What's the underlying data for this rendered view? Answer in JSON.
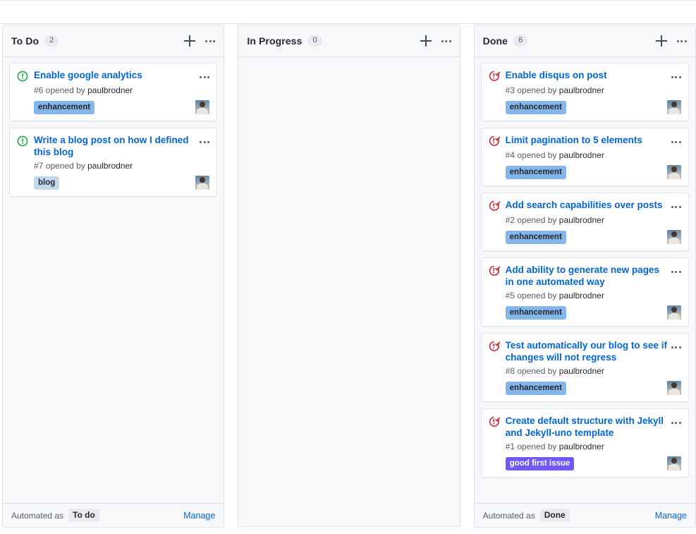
{
  "board": {
    "columns": [
      {
        "id": "todo",
        "title": "To Do",
        "count": "2",
        "add_icon": "plus-icon",
        "menu_icon": "kebab-menu-icon",
        "footer": {
          "automated_text": "Automated as",
          "badge": "To do",
          "manage": "Manage"
        },
        "cards": [
          {
            "state": "issue-opened-icon",
            "state_color": "#28a745",
            "title": "Enable google analytics",
            "meta_number": "#6",
            "meta_text": "opened by",
            "meta_author": "paulbrodner",
            "label": "enhancement",
            "label_bg": "#84b6eb",
            "label_fg": "#24292e",
            "avatar": "paulbrodner-avatar",
            "menu_icon": "card-kebab-menu-icon"
          },
          {
            "state": "issue-opened-icon",
            "state_color": "#28a745",
            "title": "Write a blog post on how I defined this blog",
            "meta_number": "#7",
            "meta_text": "opened by",
            "meta_author": "paulbrodner",
            "label": "blog",
            "label_bg": "#c5d9ed",
            "label_fg": "#24292e",
            "avatar": "paulbrodner-avatar",
            "menu_icon": "card-kebab-menu-icon"
          }
        ]
      },
      {
        "id": "inprogress",
        "title": "In Progress",
        "count": "0",
        "add_icon": "plus-icon",
        "menu_icon": "kebab-menu-icon",
        "footer": null,
        "cards": []
      },
      {
        "id": "done",
        "title": "Done",
        "count": "6",
        "add_icon": "plus-icon",
        "menu_icon": "kebab-menu-icon",
        "footer": {
          "automated_text": "Automated as",
          "badge": "Done",
          "manage": "Manage"
        },
        "cards": [
          {
            "state": "issue-closed-icon",
            "state_color": "#cb2431",
            "title": "Enable disqus on post",
            "meta_number": "#3",
            "meta_text": "opened by",
            "meta_author": "paulbrodner",
            "label": "enhancement",
            "label_bg": "#84b6eb",
            "label_fg": "#24292e",
            "avatar": "paulbrodner-avatar",
            "menu_icon": "card-kebab-menu-icon"
          },
          {
            "state": "issue-closed-icon",
            "state_color": "#cb2431",
            "title": "Limit pagination to 5 elements",
            "meta_number": "#4",
            "meta_text": "opened by",
            "meta_author": "paulbrodner",
            "label": "enhancement",
            "label_bg": "#84b6eb",
            "label_fg": "#24292e",
            "avatar": "paulbrodner-avatar",
            "menu_icon": "card-kebab-menu-icon"
          },
          {
            "state": "issue-closed-icon",
            "state_color": "#cb2431",
            "title": "Add search capabilities over posts",
            "meta_number": "#2",
            "meta_text": "opened by",
            "meta_author": "paulbrodner",
            "label": "enhancement",
            "label_bg": "#84b6eb",
            "label_fg": "#24292e",
            "avatar": "paulbrodner-avatar",
            "menu_icon": "card-kebab-menu-icon"
          },
          {
            "state": "issue-closed-icon",
            "state_color": "#cb2431",
            "title": "Add ability to generate new pages in one automated way",
            "meta_number": "#5",
            "meta_text": "opened by",
            "meta_author": "paulbrodner",
            "label": "enhancement",
            "label_bg": "#84b6eb",
            "label_fg": "#24292e",
            "avatar": "paulbrodner-avatar",
            "menu_icon": "card-kebab-menu-icon"
          },
          {
            "state": "issue-closed-icon",
            "state_color": "#cb2431",
            "title": "Test automatically our blog to see if changes will not regress",
            "meta_number": "#8",
            "meta_text": "opened by",
            "meta_author": "paulbrodner",
            "label": "enhancement",
            "label_bg": "#84b6eb",
            "label_fg": "#24292e",
            "avatar": "paulbrodner-avatar",
            "menu_icon": "card-kebab-menu-icon"
          },
          {
            "state": "issue-closed-icon",
            "state_color": "#cb2431",
            "title": "Create default structure with Jekyll and Jekyll-uno template",
            "meta_number": "#1",
            "meta_text": "opened by",
            "meta_author": "paulbrodner",
            "label": "good first issue",
            "label_bg": "#7057ff",
            "label_fg": "#ffffff",
            "avatar": "paulbrodner-avatar",
            "menu_icon": "card-kebab-menu-icon"
          }
        ]
      }
    ]
  },
  "colors": {
    "link": "#0366d6",
    "open": "#28a745",
    "closed": "#cb2431",
    "column_bg": "#f7f8fa",
    "border": "#dfe2e5"
  }
}
